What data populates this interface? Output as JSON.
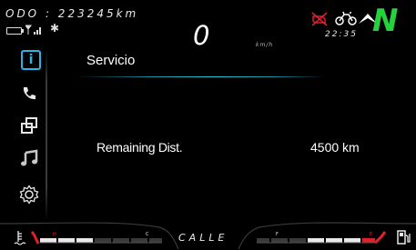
{
  "status_bar": {
    "odometer": "ODO : 223245km",
    "speed": "0",
    "speed_unit": "km/h",
    "clock": "22:35",
    "gear": "N",
    "icons": [
      "battery-icon",
      "signal-icon",
      "bluetooth-icon",
      "engine-warning-icon",
      "traction-control-icon",
      "ride-mode-icon"
    ],
    "bluetooth_glyph": "✱"
  },
  "sidebar": {
    "items": [
      {
        "name": "info",
        "icon": "info-icon",
        "glyph": "i",
        "active": true
      },
      {
        "name": "phone",
        "icon": "phone-icon",
        "active": false
      },
      {
        "name": "media-switch",
        "icon": "window-switch-icon",
        "active": false
      },
      {
        "name": "music",
        "icon": "music-icon",
        "active": false
      },
      {
        "name": "settings",
        "icon": "gear-icon",
        "active": false
      }
    ]
  },
  "main": {
    "title": "Servicio",
    "row": {
      "label": "Remaining Dist.",
      "value": "4500 km"
    }
  },
  "gauges": {
    "temperature": {
      "low": "C",
      "high": "H",
      "icon": "coolant-icon"
    },
    "fuel": {
      "low": "E",
      "high": "F",
      "icon": "fuel-pump-icon"
    },
    "ride_mode": "CALLE"
  },
  "colors": {
    "accent": "#25b8e6",
    "gear": "#25d23d",
    "warning": "#e0202a",
    "title_rule": "#24c7d8"
  }
}
